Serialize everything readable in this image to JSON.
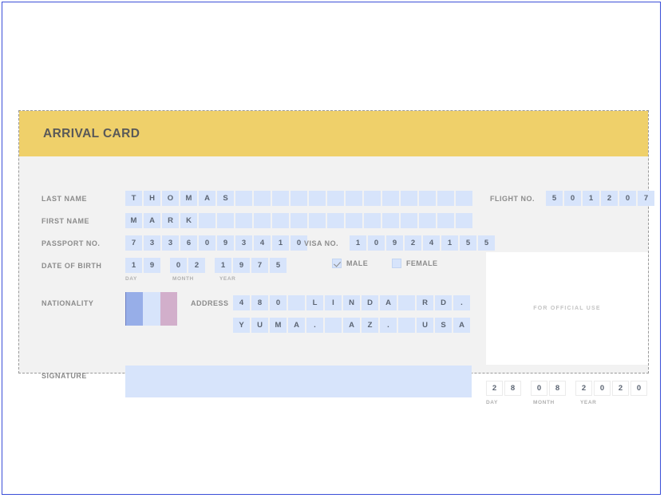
{
  "card": {
    "title": "ARRIVAL CARD",
    "header_color": "#efd06a",
    "body_color": "#f2f2f2",
    "box_color": "#d7e4fb"
  },
  "fields": {
    "last_name": {
      "label": "LAST NAME",
      "value": "THOMAS",
      "boxes": 19
    },
    "first_name": {
      "label": "FIRST NAME",
      "value": "MARK",
      "boxes": 19
    },
    "passport_no": {
      "label": "PASSPORT NO.",
      "value": "7336093410",
      "boxes": 10
    },
    "visa_no": {
      "label": "VISA NO.",
      "value": "10924155",
      "boxes": 8
    },
    "date_of_birth": {
      "label": "DATE OF BIRTH",
      "day": "19",
      "month": "02",
      "year": "1975",
      "day_label": "DAY",
      "month_label": "MONTH",
      "year_label": "YEAR"
    },
    "sex": {
      "male_label": "MALE",
      "female_label": "FEMALE",
      "male_checked": true,
      "female_checked": false
    },
    "nationality": {
      "label": "NATIONALITY",
      "flag_colors": [
        "#97aee8",
        "#d7e4fb",
        "#d2afcb"
      ]
    },
    "address": {
      "label": "ADDRESS",
      "line1": "480 LINDA RD.",
      "line2": "YUMA. AZ. USA",
      "boxes_per_line": 13
    },
    "signature": {
      "label": "SIGNATURE",
      "value": ""
    },
    "flight_no": {
      "label": "FLIGHT NO.",
      "value": "501207",
      "boxes": 6
    },
    "official_use": {
      "text": "FOR OFFICIAL USE"
    },
    "arrival_date": {
      "day": "28",
      "month": "08",
      "year": "2020",
      "day_label": "DAY",
      "month_label": "MONTH",
      "year_label": "YEAR"
    }
  }
}
